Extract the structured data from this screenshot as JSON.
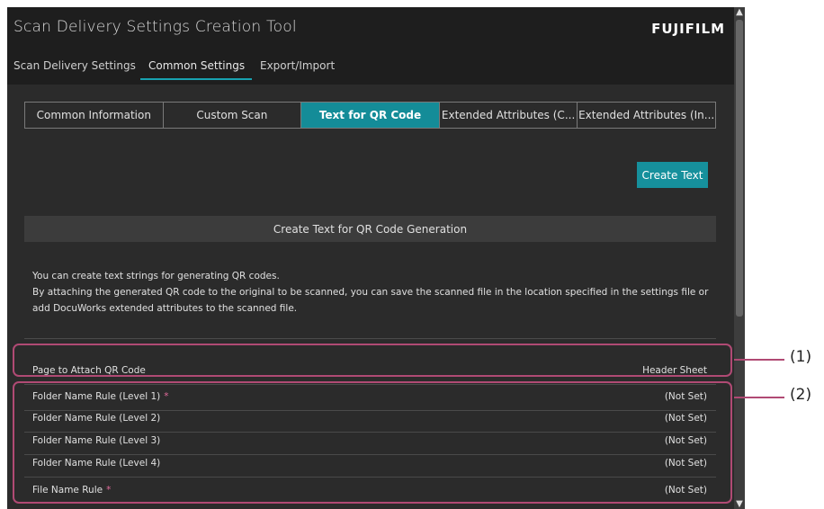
{
  "app": {
    "title": "Scan Delivery Settings Creation Tool",
    "brand": "FUJIFILM"
  },
  "menu": [
    {
      "label": "Scan Delivery Settings"
    },
    {
      "label": "Common Settings"
    },
    {
      "label": "Export/Import"
    }
  ],
  "tabs": [
    {
      "label": "Common Information"
    },
    {
      "label": "Custom Scan"
    },
    {
      "label": "Text for QR Code"
    },
    {
      "label": "Extended Attributes (C..."
    },
    {
      "label": "Extended Attributes (In..."
    }
  ],
  "actions": {
    "create_text": "Create Text"
  },
  "section": {
    "header": "Create Text for QR Code Generation",
    "desc_line1": "You can create text strings for generating QR codes.",
    "desc_line2": "By attaching the generated QR code to the original to be scanned, you can save the scanned file in the location specified in the settings file or add DocuWorks extended attributes to the scanned file."
  },
  "rows": [
    {
      "label": "Page to Attach QR Code",
      "required": "",
      "value": "Header Sheet"
    },
    {
      "label": "Folder Name Rule (Level 1)",
      "required": "*",
      "value": "(Not Set)"
    },
    {
      "label": "Folder Name Rule (Level 2)",
      "required": "",
      "value": "(Not Set)"
    },
    {
      "label": "Folder Name Rule (Level 3)",
      "required": "",
      "value": "(Not Set)"
    },
    {
      "label": "Folder Name Rule (Level 4)",
      "required": "",
      "value": "(Not Set)"
    },
    {
      "label": "File Name Rule",
      "required": "*",
      "value": "(Not Set)"
    }
  ],
  "callouts": {
    "c1": "(1)",
    "c2": "(2)"
  },
  "colors": {
    "accent": "#148c98",
    "callout": "#b04a74",
    "required": "#e06a9a"
  }
}
